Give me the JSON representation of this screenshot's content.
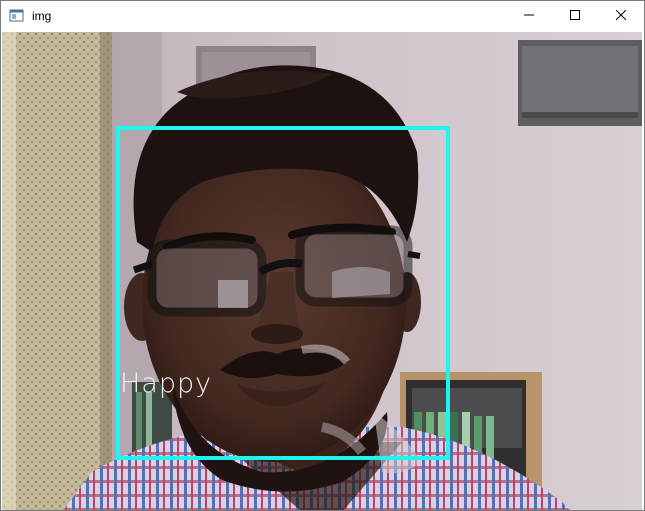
{
  "window": {
    "title": "img"
  },
  "titlebar_icons": {
    "app": "app-window-icon",
    "minimize": "minimize-icon",
    "maximize": "maximize-icon",
    "close": "close-icon"
  },
  "detection": {
    "label": "Happy",
    "box_color": "#1ff4ee"
  }
}
